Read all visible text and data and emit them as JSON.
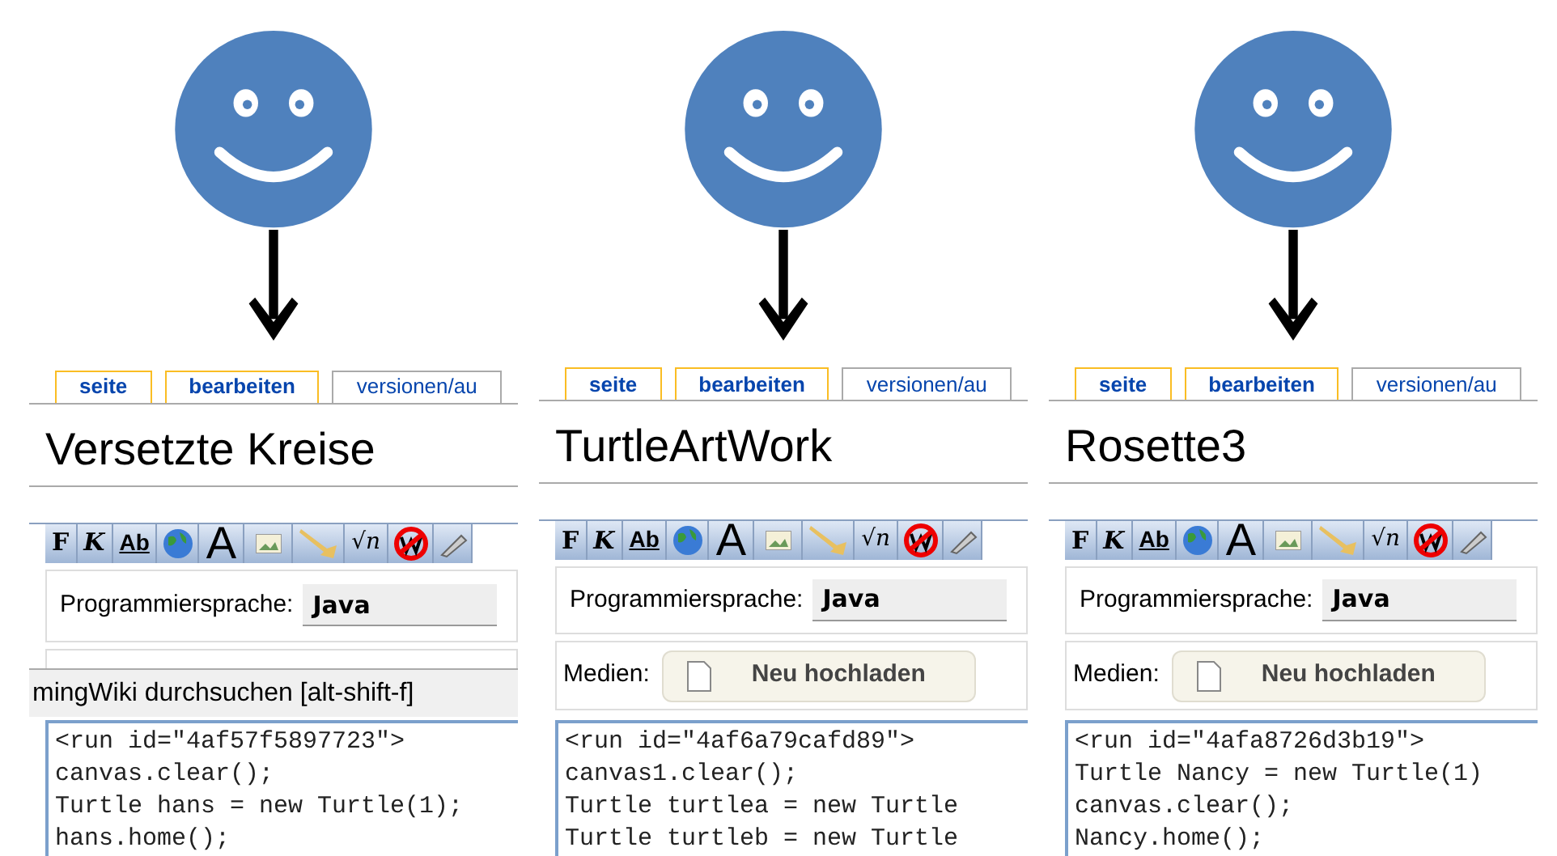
{
  "panels": [
    {
      "tabs": [
        {
          "label": "seite",
          "highlighted": true
        },
        {
          "label": "bearbeiten",
          "highlighted": true
        },
        {
          "label": "versionen/au",
          "highlighted": false
        }
      ],
      "title": "Versetzte Kreise",
      "toolbar": [
        {
          "kind": "text",
          "label": "F"
        },
        {
          "kind": "text",
          "label": "K"
        },
        {
          "kind": "text",
          "label": "Ab"
        },
        {
          "kind": "globe"
        },
        {
          "kind": "text",
          "label": "A"
        },
        {
          "kind": "image"
        },
        {
          "kind": "horn"
        },
        {
          "kind": "text",
          "label": "√n"
        },
        {
          "kind": "nowiki"
        },
        {
          "kind": "pen"
        }
      ],
      "language": {
        "label": "Programmiersprache:",
        "value": "Java"
      },
      "tooltip": "mingWiki durchsuchen [alt-shift-f]",
      "code": [
        "<run id=\"4af57f5897723\">",
        "canvas.clear();",
        "Turtle hans = new Turtle(1);",
        "hans.home();"
      ]
    },
    {
      "tabs": [
        {
          "label": "seite",
          "highlighted": true
        },
        {
          "label": "bearbeiten",
          "highlighted": true
        },
        {
          "label": "versionen/au",
          "highlighted": false
        }
      ],
      "title": "TurtleArtWork",
      "toolbar": [
        {
          "kind": "text",
          "label": "F"
        },
        {
          "kind": "text",
          "label": "K"
        },
        {
          "kind": "text",
          "label": "Ab"
        },
        {
          "kind": "globe"
        },
        {
          "kind": "text",
          "label": "A"
        },
        {
          "kind": "image"
        },
        {
          "kind": "horn"
        },
        {
          "kind": "text",
          "label": "√n"
        },
        {
          "kind": "nowiki"
        },
        {
          "kind": "pen"
        }
      ],
      "language": {
        "label": "Programmiersprache:",
        "value": "Java"
      },
      "media": {
        "label": "Medien:",
        "button": "Neu hochladen"
      },
      "code": [
        "<run id=\"4af6a79cafd89\">",
        "canvas1.clear();",
        "Turtle turtlea = new Turtle",
        "Turtle turtleb = new Turtle"
      ]
    },
    {
      "tabs": [
        {
          "label": "seite",
          "highlighted": true
        },
        {
          "label": "bearbeiten",
          "highlighted": true
        },
        {
          "label": "versionen/au",
          "highlighted": false
        }
      ],
      "title": "Rosette3",
      "toolbar": [
        {
          "kind": "text",
          "label": "F"
        },
        {
          "kind": "text",
          "label": "K"
        },
        {
          "kind": "text",
          "label": "Ab"
        },
        {
          "kind": "globe"
        },
        {
          "kind": "text",
          "label": "A"
        },
        {
          "kind": "image"
        },
        {
          "kind": "horn"
        },
        {
          "kind": "text",
          "label": "√n"
        },
        {
          "kind": "nowiki"
        },
        {
          "kind": "pen"
        }
      ],
      "language": {
        "label": "Programmiersprache:",
        "value": "Java"
      },
      "media": {
        "label": "Medien:",
        "button": "Neu hochladen"
      },
      "code": [
        "<run id=\"4afa8726d3b19\">",
        "Turtle Nancy = new Turtle(1)",
        "canvas.clear();",
        "Nancy.home();"
      ]
    }
  ]
}
